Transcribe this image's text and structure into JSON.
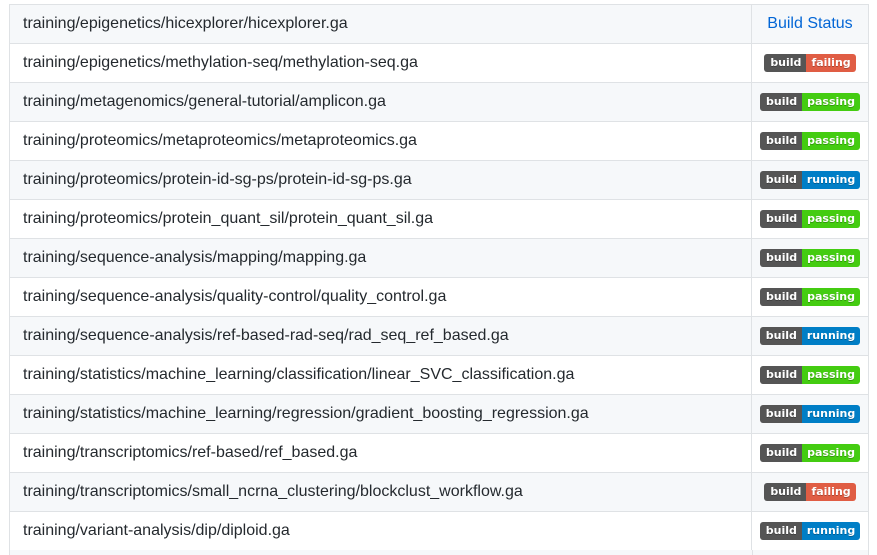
{
  "header": {
    "path": "training/epigenetics/hicexplorer/hicexplorer.ga",
    "status_link": "Build Status"
  },
  "badge_label": "build",
  "rows": [
    {
      "path": "training/epigenetics/methylation-seq/methylation-seq.ga",
      "status": "failing"
    },
    {
      "path": "training/metagenomics/general-tutorial/amplicon.ga",
      "status": "passing"
    },
    {
      "path": "training/proteomics/metaproteomics/metaproteomics.ga",
      "status": "passing"
    },
    {
      "path": "training/proteomics/protein-id-sg-ps/protein-id-sg-ps.ga",
      "status": "running"
    },
    {
      "path": "training/proteomics/protein_quant_sil/protein_quant_sil.ga",
      "status": "passing"
    },
    {
      "path": "training/sequence-analysis/mapping/mapping.ga",
      "status": "passing"
    },
    {
      "path": "training/sequence-analysis/quality-control/quality_control.ga",
      "status": "passing"
    },
    {
      "path": "training/sequence-analysis/ref-based-rad-seq/rad_seq_ref_based.ga",
      "status": "running"
    },
    {
      "path": "training/statistics/machine_learning/classification/linear_SVC_classification.ga",
      "status": "passing"
    },
    {
      "path": "training/statistics/machine_learning/regression/gradient_boosting_regression.ga",
      "status": "running"
    },
    {
      "path": "training/transcriptomics/ref-based/ref_based.ga",
      "status": "passing"
    },
    {
      "path": "training/transcriptomics/small_ncrna_clustering/blockclust_workflow.ga",
      "status": "failing"
    },
    {
      "path": "training/variant-analysis/dip/diploid.ga",
      "status": "running"
    }
  ],
  "colors": {
    "passing": "#44cc11",
    "failing": "#e05d44",
    "running": "#007ec6",
    "badge_label_bg": "#555555",
    "link": "#0366d6"
  }
}
